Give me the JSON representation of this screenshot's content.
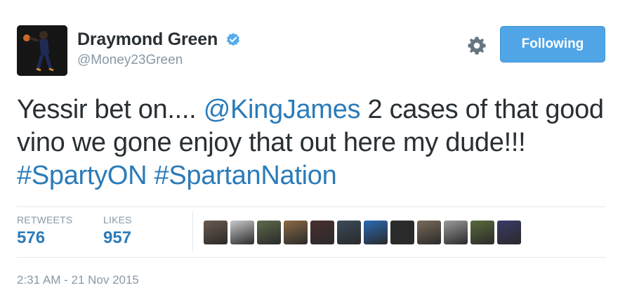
{
  "tweet": {
    "author": {
      "name": "Draymond Green",
      "handle": "@Money23Green",
      "verified": true,
      "avatar_icon": "player-avatar"
    },
    "actions": {
      "settings_icon": "gear-icon",
      "follow_label": "Following"
    },
    "text": {
      "part1": "Yessir bet on.... ",
      "mention": "@KingJames",
      "part2": " 2 cases of that good vino we gone enjoy that out here my dude!!! ",
      "hashtag1": "#SpartyON",
      "space": " ",
      "hashtag2": "#SpartanNation"
    },
    "stats": {
      "retweets_label": "RETWEETS",
      "retweets_count": "576",
      "likes_label": "LIKES",
      "likes_count": "957"
    },
    "likers": [
      {
        "color": "#6b5a4e"
      },
      {
        "color": "#c9c9c9"
      },
      {
        "color": "#5d6b4a"
      },
      {
        "color": "#8a6a45"
      },
      {
        "color": "#4a2f2f"
      },
      {
        "color": "#3b4a5a"
      },
      {
        "color": "#2a6ab5"
      },
      {
        "color": "#2b2b2b"
      },
      {
        "color": "#7a6a5a"
      },
      {
        "color": "#9a9a9a"
      },
      {
        "color": "#5a6a3a"
      },
      {
        "color": "#3a3a6a"
      }
    ],
    "timestamp": "2:31 AM - 21 Nov 2015",
    "colors": {
      "link": "#2b7bb9",
      "button": "#50a5e6",
      "muted": "#8899a6"
    }
  }
}
